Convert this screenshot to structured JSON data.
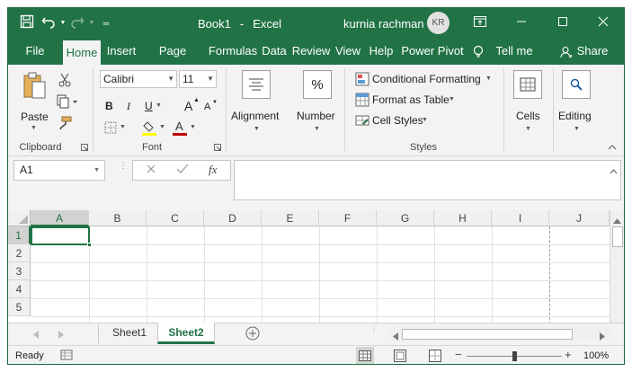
{
  "title_bar": {
    "document": "Book1",
    "separator": "-",
    "app": "Excel",
    "user_name": "kurnia rachman",
    "user_initials": "KR"
  },
  "tabs": [
    "File",
    "Home",
    "Insert",
    "Page Layout",
    "Formulas",
    "Data",
    "Review",
    "View",
    "Help",
    "Power Pivot",
    "Tell me",
    "Share"
  ],
  "ribbon": {
    "clipboard": {
      "paste_label": "Paste",
      "group_label": "Clipboard"
    },
    "font": {
      "name": "Calibri",
      "size": "11",
      "bold": "B",
      "italic": "I",
      "underline": "U",
      "grow": "A",
      "shrink": "A",
      "group_label": "Font"
    },
    "alignment_label": "Alignment",
    "number_label": "Number",
    "number_icon": "%",
    "styles": {
      "conditional": "Conditional Formatting",
      "table": "Format as Table",
      "cell_styles": "Cell Styles",
      "group_label": "Styles"
    },
    "cells_label": "Cells",
    "editing_label": "Editing"
  },
  "formula_bar": {
    "name_box": "A1",
    "fx": "fx",
    "value": ""
  },
  "grid": {
    "columns": [
      "A",
      "B",
      "C",
      "D",
      "E",
      "F",
      "G",
      "H",
      "I",
      "J"
    ],
    "rows": [
      "1",
      "2",
      "3",
      "4",
      "5"
    ],
    "selected_cell": "A1"
  },
  "sheets": {
    "tabs": [
      "Sheet1",
      "Sheet2"
    ],
    "active": "Sheet2"
  },
  "status_bar": {
    "ready": "Ready",
    "zoom": "100%",
    "minus": "−",
    "plus": "+"
  },
  "colors": {
    "accent": "#217346",
    "active_sheet_text": "#217346",
    "selection": "#217346",
    "font_color_bar": "#c00000",
    "highlight_bar": "#ffff00"
  }
}
